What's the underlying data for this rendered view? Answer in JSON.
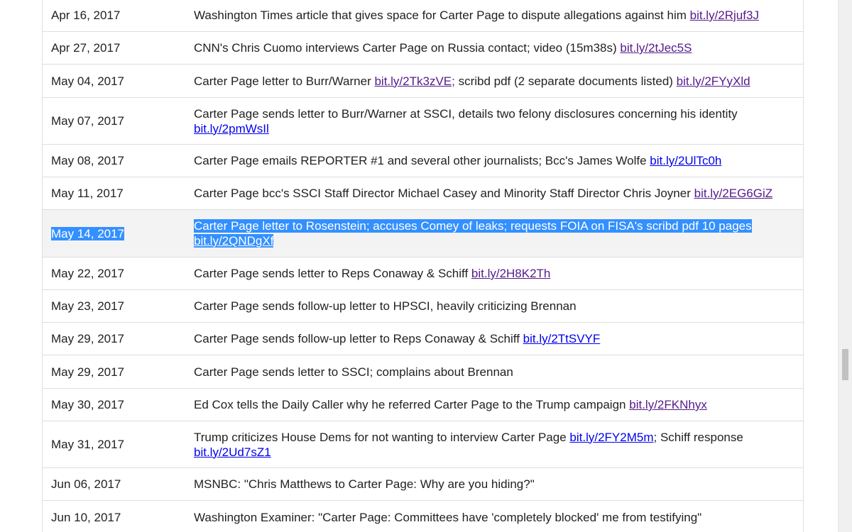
{
  "timeline": {
    "rows": [
      {
        "date": "Apr 16, 2017",
        "text": "Washington Times article that gives space for Carter Page to dispute allegations against him ",
        "link1": "bit.ly/2Rjuf3J"
      },
      {
        "date": "Apr 27, 2017",
        "text": "CNN's Chris Cuomo interviews Carter Page on Russia contact; video (15m38s) ",
        "link1": "bit.ly/2tJec5S"
      },
      {
        "date": "May 04, 2017",
        "text": "Carter Page letter to Burr/Warner ",
        "link1": "bit.ly/2Tk3zVE;",
        "text2": " scribd pdf (2 separate documents listed) ",
        "link2": "bit.ly/2FYyXld"
      },
      {
        "date": "May 07, 2017",
        "text": "Carter Page sends letter to Burr/Warner at SSCI, details two felony disclosures concerning his identity ",
        "link1": "bit.ly/2pmWsIl"
      },
      {
        "date": "May 08, 2017",
        "text": "Carter Page emails REPORTER #1 and several other journalists; Bcc's James Wolfe ",
        "link1": "bit.ly/2UlTc0h"
      },
      {
        "date": "May 11, 2017",
        "text": "Carter Page bcc's SSCI Staff Director Michael Casey and Minority Staff Director Chris Joyner ",
        "link1": "bit.ly/2EG6GiZ"
      },
      {
        "date": "May 14, 2017",
        "text": "Carter Page letter to Rosenstein; accuses Comey of leaks; requests FOIA on FISA's scribd pdf 10 pages ",
        "link1": "bit.ly/2QNDgXf"
      },
      {
        "date": "May 22, 2017",
        "text": "Carter Page sends letter to Reps Conaway & Schiff ",
        "link1": "bit.ly/2H8K2Th"
      },
      {
        "date": "May 23, 2017",
        "text": "Carter Page sends follow-up letter to HPSCI, heavily criticizing Brennan"
      },
      {
        "date": "May 29, 2017",
        "text": "Carter Page sends follow-up letter to Reps Conaway & Schiff ",
        "link1": "bit.ly/2TtSVYF"
      },
      {
        "date": "May 29, 2017",
        "text": "Carter Page sends letter to SSCI; complains about Brennan"
      },
      {
        "date": "May 30, 2017",
        "text": "Ed Cox tells the Daily Caller why he referred Carter Page to the Trump campaign ",
        "link1": "bit.ly/2FKNhyx"
      },
      {
        "date": "May 31, 2017",
        "text": "Trump criticizes House Dems for not wanting to interview Carter Page ",
        "link1": "bit.ly/2FY2M5m",
        "text2": "; Schiff response ",
        "link2": "bit.ly/2Ud7sZ1"
      },
      {
        "date": "Jun 06, 2017",
        "text": "MSNBC: \"Chris Matthews to Carter Page: Why are you hiding?\""
      },
      {
        "date": "Jun 10, 2017",
        "text": "Washington Examiner: \"Carter Page: Committees have 'completely blocked' me from testifying\""
      }
    ]
  },
  "colors": {
    "visited_link": "#551a8b",
    "unvisited_link": "#0000ee",
    "selection": "#3390ff",
    "row_border": "#dedede",
    "highlight_row": "#f3f3f3"
  }
}
